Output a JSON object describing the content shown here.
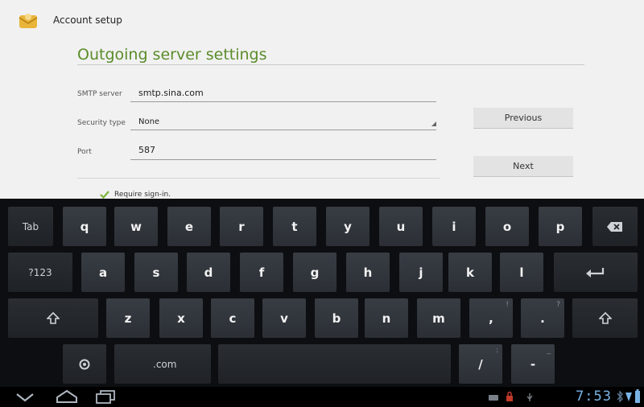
{
  "app": {
    "title": "Account setup"
  },
  "form": {
    "heading": "Outgoing server settings",
    "smtp_label": "SMTP server",
    "smtp_value": "smtp.sina.com",
    "security_label": "Security type",
    "security_value": "None",
    "port_label": "Port",
    "port_value": "587",
    "require_signin_label": "Require sign-in."
  },
  "buttons": {
    "previous": "Previous",
    "next": "Next"
  },
  "keyboard": {
    "row1": [
      "q",
      "w",
      "e",
      "r",
      "t",
      "y",
      "u",
      "i",
      "o",
      "p"
    ],
    "row2": [
      "a",
      "s",
      "d",
      "f",
      "g",
      "h",
      "j",
      "k",
      "l"
    ],
    "row3": [
      "z",
      "x",
      "c",
      "v",
      "b",
      "n",
      "m",
      ",",
      "."
    ],
    "tab": "Tab",
    "symbols": "?123",
    "dotcom": ".com",
    "slash": "/",
    "dash": "-",
    "comma_hint": "!",
    "period_hint": "?",
    "slash_hint": ":",
    "dash_hint": "_"
  },
  "status": {
    "time": "7:53"
  },
  "colors": {
    "heading": "#5b8c2a",
    "keyboard_bg": "#0d0e11",
    "clock": "#7ab4e6"
  }
}
